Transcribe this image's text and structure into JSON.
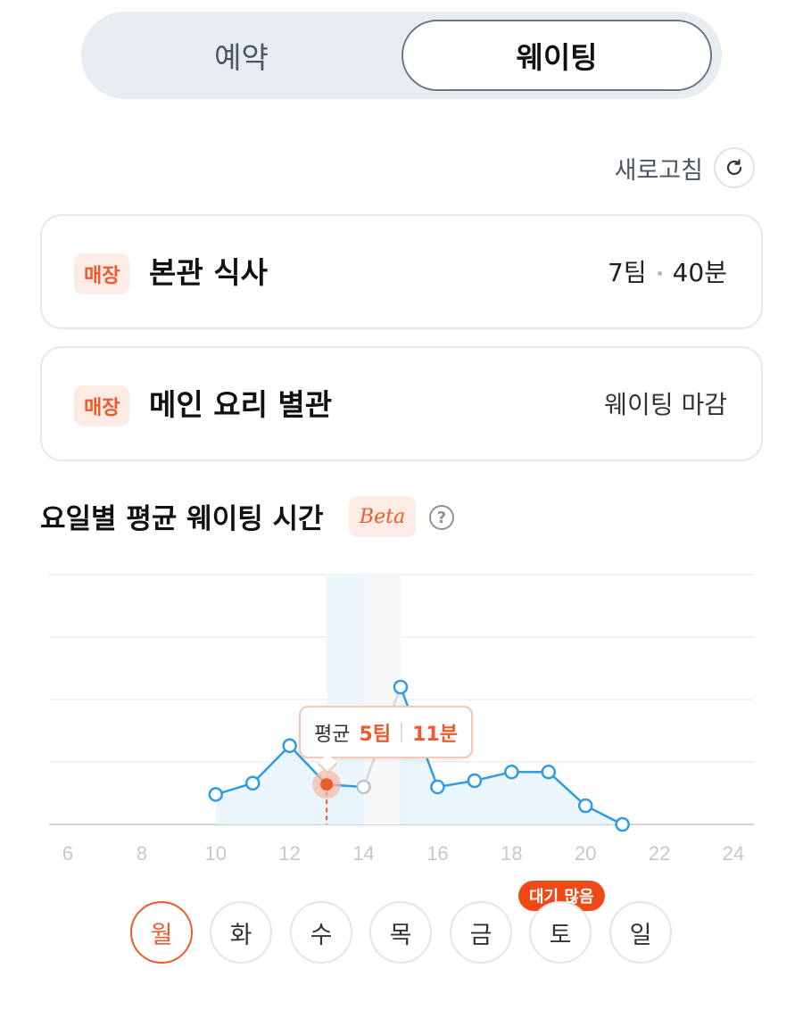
{
  "tabs": {
    "reservation": "예약",
    "waiting": "웨이팅"
  },
  "refresh": {
    "label": "새로고침",
    "icon": "refresh-icon"
  },
  "cards": [
    {
      "badge": "매장",
      "title": "본관 식사",
      "teams": "7팀",
      "time": "40분"
    },
    {
      "badge": "매장",
      "title": "메인 요리 별관",
      "status": "웨이팅 마감"
    }
  ],
  "section": {
    "title": "요일별 평균 웨이팅 시간",
    "beta": "Beta",
    "help_icon": "question-icon",
    "help_glyph": "?"
  },
  "tooltip": {
    "label": "평균",
    "teams": "5팀",
    "time": "11분"
  },
  "days": [
    "월",
    "화",
    "수",
    "목",
    "금",
    "토",
    "일"
  ],
  "selected_day": "월",
  "busy_label": "대기 많음",
  "colors": {
    "accent": "#ef5a2a",
    "line": "#2f9be0",
    "area": "#e6f3fc",
    "grid": "#eceef0"
  },
  "chart_data": {
    "type": "line",
    "x_ticks": [
      6,
      8,
      10,
      12,
      14,
      16,
      18,
      20,
      22,
      24
    ],
    "xlim": [
      6,
      24
    ],
    "ylim": [
      0,
      4
    ],
    "y_gridlines": [
      0,
      1,
      2,
      3,
      4
    ],
    "segments": [
      {
        "x": [
          10,
          11,
          12,
          13,
          14
        ],
        "y": [
          0.48,
          0.66,
          1.26,
          0.64,
          0.6
        ]
      },
      {
        "x": [
          15,
          16,
          17,
          18,
          19,
          20,
          21
        ],
        "y": [
          2.2,
          0.6,
          0.7,
          0.84,
          0.84,
          0.3,
          0
        ]
      }
    ],
    "gap": {
      "x": [
        14,
        15
      ],
      "y": [
        0.6,
        2.2
      ]
    },
    "selected": {
      "x": 13,
      "y": 0.64
    }
  }
}
